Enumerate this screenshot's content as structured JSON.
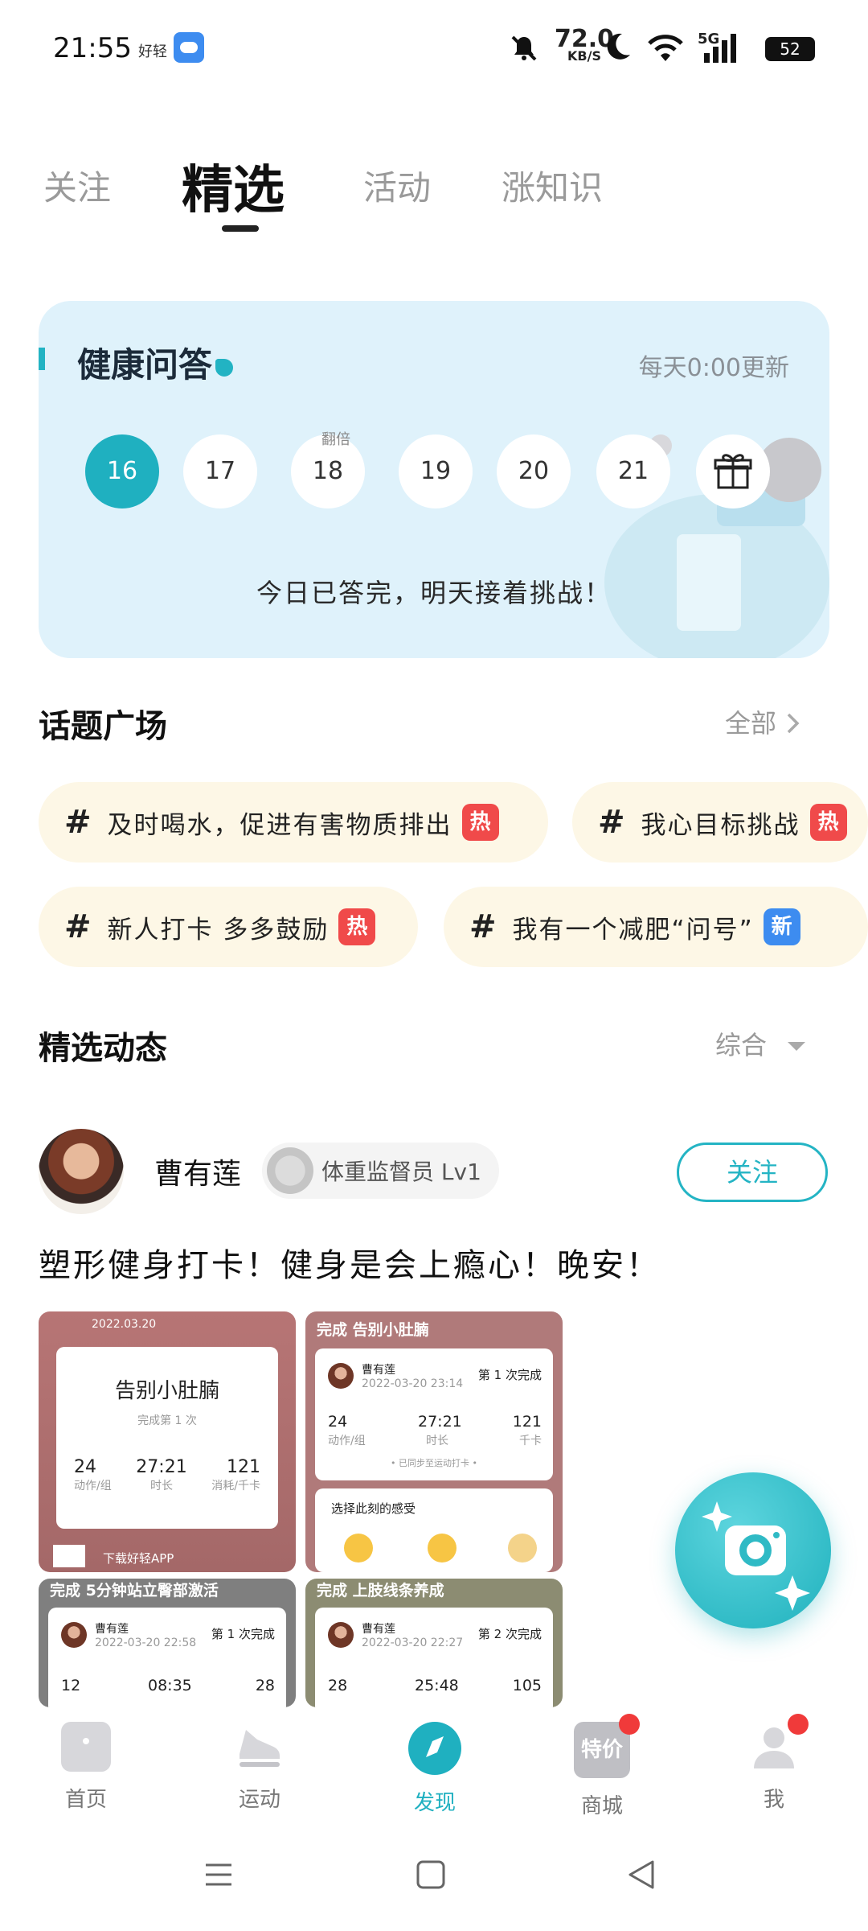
{
  "status_bar": {
    "time": "21:55",
    "app_label": "好轻",
    "net_speed": "72.0",
    "net_unit": "KB/S",
    "signal_label": "5G",
    "battery": "52"
  },
  "tabs": [
    {
      "label": "关注",
      "active": false
    },
    {
      "label": "精选",
      "active": true
    },
    {
      "label": "活动",
      "active": false
    },
    {
      "label": "涨知识",
      "active": false
    }
  ],
  "qa_card": {
    "logo": "健康问答",
    "update_text": "每天0:00更新",
    "days": [
      {
        "label": "16",
        "active": true,
        "tag": ""
      },
      {
        "label": "17",
        "active": false,
        "tag": ""
      },
      {
        "label": "18",
        "active": false,
        "tag": "翻倍"
      },
      {
        "label": "19",
        "active": false,
        "tag": ""
      },
      {
        "label": "20",
        "active": false,
        "tag": ""
      },
      {
        "label": "21",
        "active": false,
        "tag": ""
      }
    ],
    "message": "今日已答完，明天接着挑战！"
  },
  "topic_square": {
    "title": "话题广场",
    "more": "全部",
    "chips": [
      {
        "text": "及时喝水，促进有害物质排出",
        "badge": "热",
        "badge_type": "hot"
      },
      {
        "text": "我心目标挑战",
        "badge": "热",
        "badge_type": "hot"
      },
      {
        "text": "新人打卡 多多鼓励",
        "badge": "热",
        "badge_type": "hot"
      },
      {
        "text": "我有一个减肥“问号”",
        "badge": "新",
        "badge_type": "new"
      }
    ]
  },
  "feed": {
    "title": "精选动态",
    "sort": "综合",
    "post": {
      "author": "曹有莲",
      "rank": "体重监督员 Lv1",
      "follow": "关注",
      "text": "塑形健身打卡！健身是会上瘾心！晚安！",
      "images": [
        {
          "date": "2022.03.20",
          "title": "告别小肚腩",
          "subtitle": "完成第 1 次",
          "stats": [
            {
              "value": "24",
              "label": "动作/组"
            },
            {
              "value": "27:21",
              "label": "时长"
            },
            {
              "value": "121",
              "label": "消耗/千卡"
            }
          ],
          "footer": "下载好轻APP"
        },
        {
          "header": "完成 告别小肚腩",
          "user": "曹有莲",
          "datetime": "2022-03-20 23:14",
          "count": "第 1 次完成",
          "stats": [
            {
              "value": "24",
              "label": "动作/组"
            },
            {
              "value": "27:21",
              "label": "时长"
            },
            {
              "value": "121",
              "label": "千卡"
            }
          ],
          "note": "• 已同步至运动打卡 •",
          "feeling": "选择此刻的感受"
        },
        {
          "header": "完成 5分钟站立臀部激活",
          "user": "曹有莲",
          "datetime": "2022-03-20 22:58",
          "count": "第 1 次完成",
          "stats": [
            {
              "value": "12"
            },
            {
              "value": "08:35"
            },
            {
              "value": "28"
            }
          ]
        },
        {
          "header": "完成 上肢线条养成",
          "user": "曹有莲",
          "datetime": "2022-03-20 22:27",
          "count": "第 2 次完成",
          "stats": [
            {
              "value": "28"
            },
            {
              "value": "25:48"
            },
            {
              "value": "105"
            }
          ]
        }
      ]
    }
  },
  "bottom_nav": [
    {
      "label": "首页",
      "active": false,
      "dot": false
    },
    {
      "label": "运动",
      "active": false,
      "dot": false
    },
    {
      "label": "发现",
      "active": true,
      "dot": false
    },
    {
      "label": "商城",
      "active": false,
      "dot": true,
      "icon_text": "特价"
    },
    {
      "label": "我",
      "active": false,
      "dot": true
    }
  ],
  "colors": {
    "accent": "#1fb0c0",
    "hot": "#f04a4a",
    "new": "#3d8cf0",
    "qa_bg": "#dff2fb",
    "chip_bg": "#fdf7e6"
  }
}
